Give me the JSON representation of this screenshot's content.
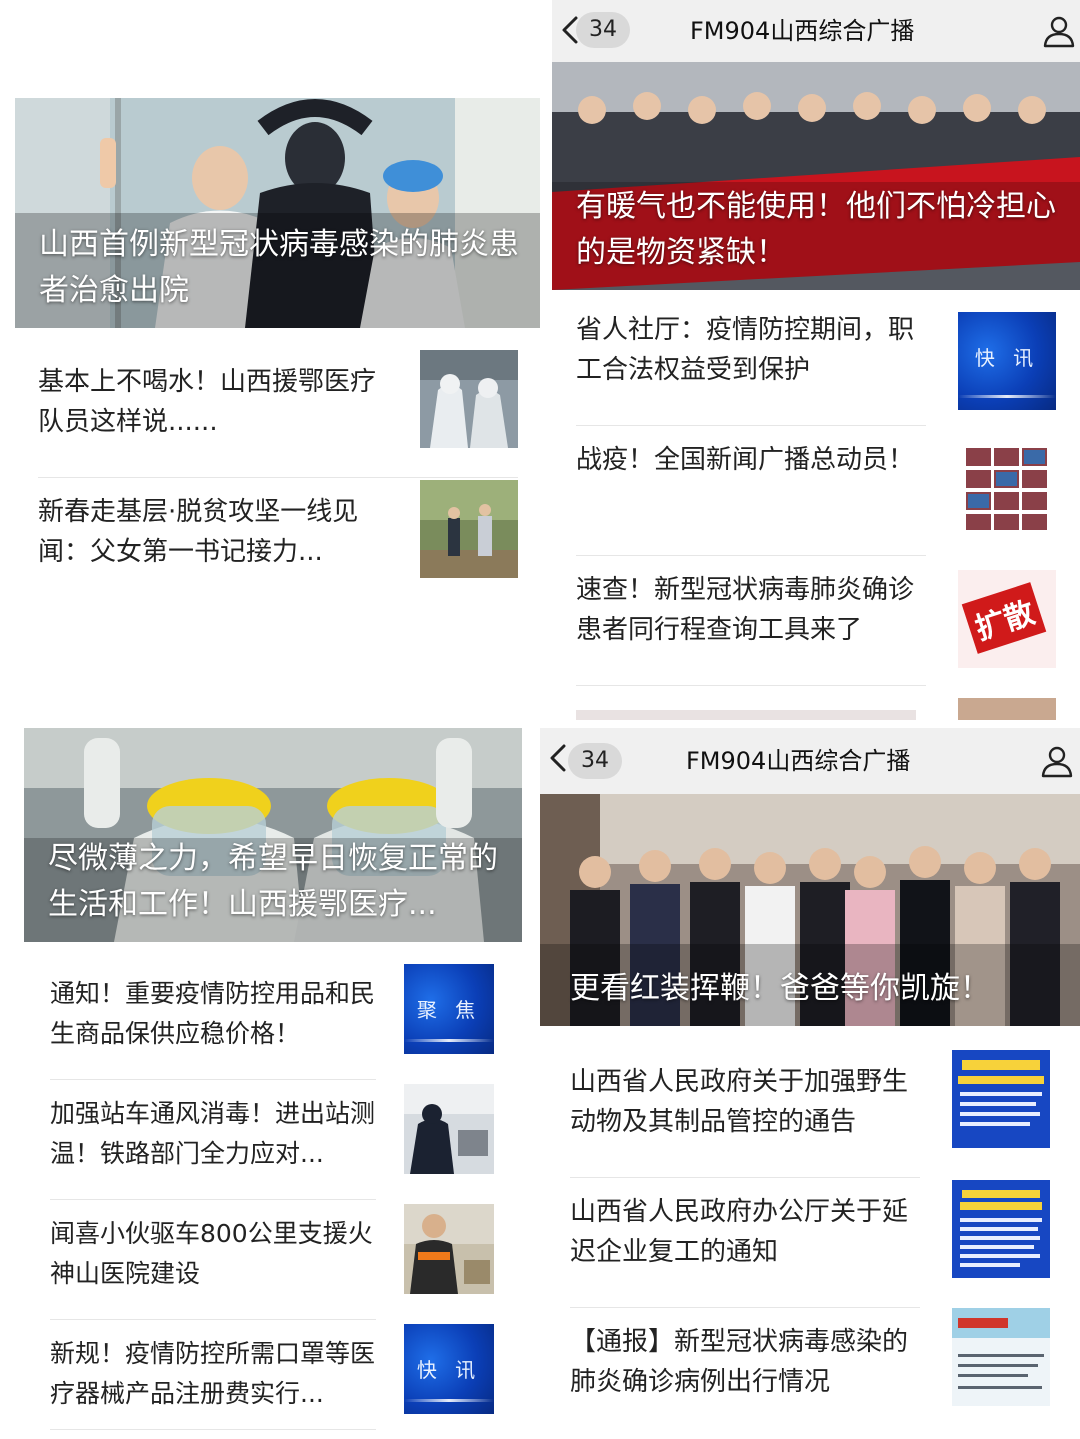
{
  "colors": {
    "bar_bg": "#f0f0f0",
    "badge_bg": "#d9d9d9",
    "divider": "#e6e6e6",
    "brand_blue": "#0b3fb7",
    "banner_red": "#c8141e"
  },
  "top_left": {
    "hero_title": "山西首例新型冠状病毒感染的肺炎患者治愈出院",
    "items": [
      {
        "text": "基本上不喝水！山西援鄂医疗队员这样说......",
        "thumb": "medical-staff-photo"
      },
      {
        "text": "新春走基层·脱贫攻坚一线见闻：父女第一书记接力...",
        "thumb": "village-visit-photo"
      }
    ]
  },
  "top_right": {
    "nav": {
      "back_icon": "chevron-left-icon",
      "count": "34",
      "title": "FM904山西综合广播",
      "user_icon": "user-icon"
    },
    "hero_title": "有暖气也不能使用！他们不怕冷担心的是物资紧缺！",
    "items": [
      {
        "text": "省人社厅：疫情防控期间，职工合法权益受到保护",
        "thumb_word": "快 讯"
      },
      {
        "text": "战疫！全国新闻广播总动员！",
        "thumb": "video-grid-photo"
      },
      {
        "text": "速查！新型冠状病毒肺炎确诊患者同行程查询工具来了",
        "thumb_word": "扩散"
      }
    ]
  },
  "bottom_left": {
    "hero_title": "尽微薄之力，希望早日恢复正常的生活和工作！山西援鄂医疗...",
    "items": [
      {
        "text": "通知！重要疫情防控用品和民生商品保供应稳价格！",
        "thumb_word": "聚 焦"
      },
      {
        "text": "加强站车通风消毒！进出站测温！铁路部门全力应对...",
        "thumb": "station-temperature-photo"
      },
      {
        "text": "闻喜小伙驱车800公里支援火神山医院建设",
        "thumb": "worker-vest-photo"
      },
      {
        "text": "新规！疫情防控所需口罩等医疗器械产品注册费实行...",
        "thumb_word": "快 讯"
      }
    ]
  },
  "bottom_right": {
    "nav": {
      "back_icon": "chevron-left-icon",
      "count": "34",
      "title": "FM904山西综合广播",
      "user_icon": "user-icon"
    },
    "hero_title": "更看红装挥鞭！爸爸等你凯旋！",
    "items": [
      {
        "text": "山西省人民政府关于加强野生动物及其制品管控的通告",
        "thumb": "government-notice-blue"
      },
      {
        "text": "山西省人民政府办公厅关于延迟企业复工的通知",
        "thumb": "government-notice-blue"
      },
      {
        "text": "【通报】新型冠状病毒感染的肺炎确诊病例出行情况",
        "thumb": "government-website-screenshot"
      }
    ]
  }
}
